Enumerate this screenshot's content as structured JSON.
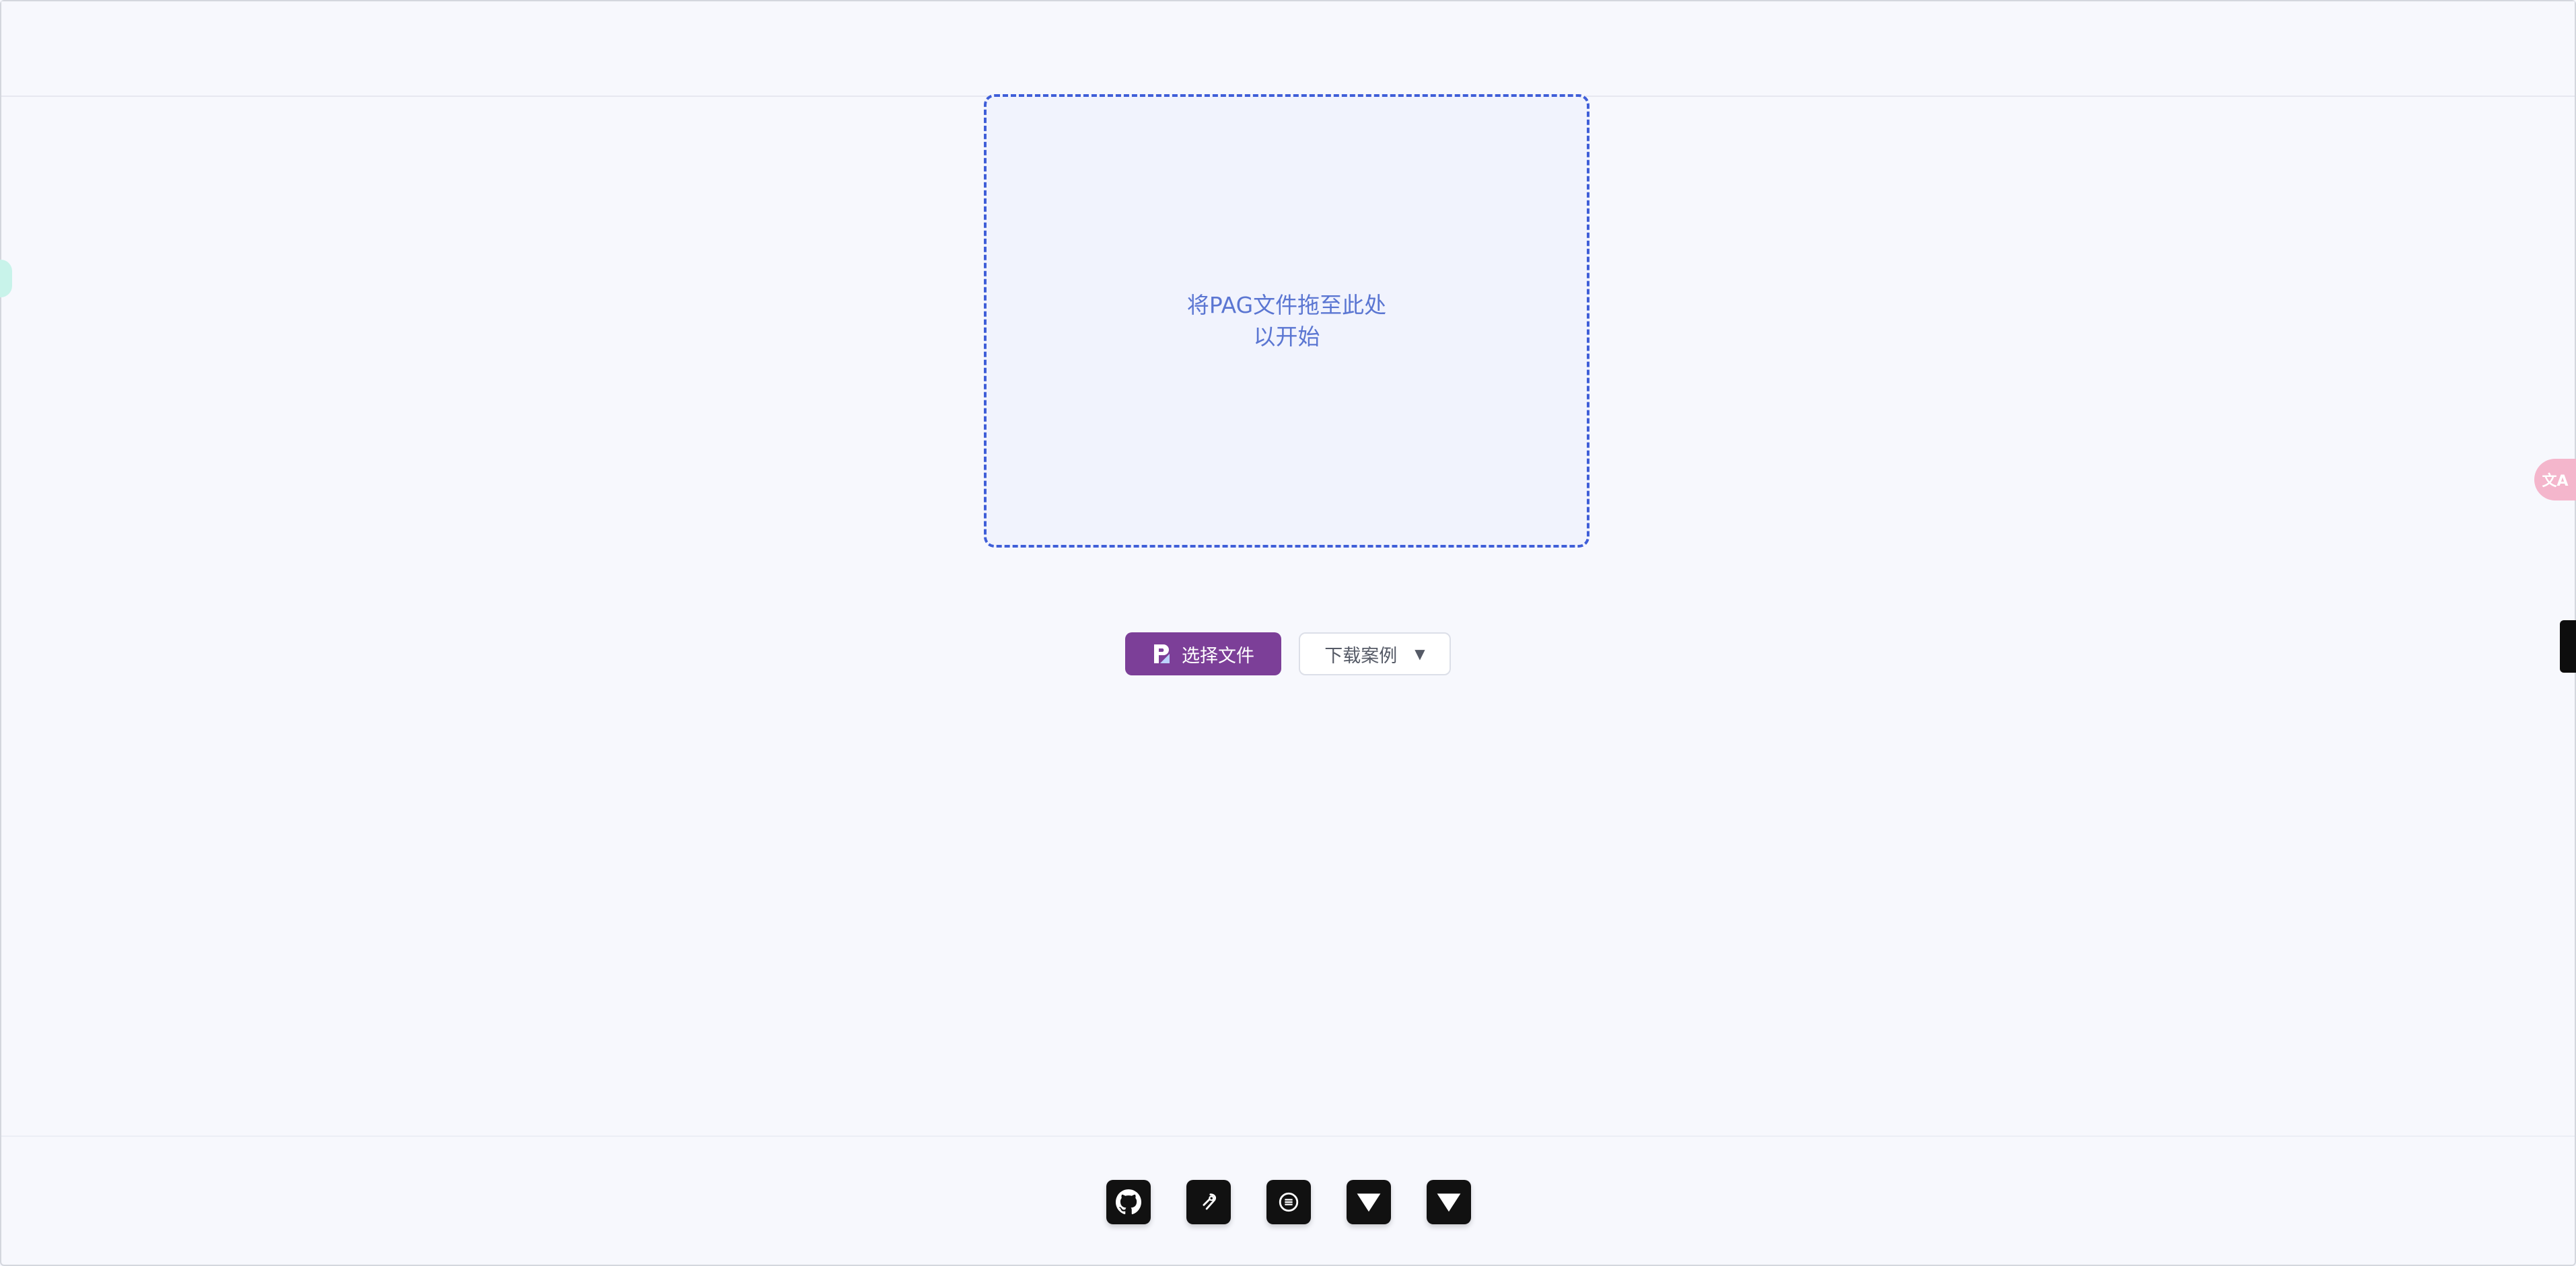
{
  "dropzone": {
    "line1": "将PAG文件拖至此处",
    "line2": "以开始"
  },
  "actions": {
    "choose_file_label": "选择文件",
    "download_examples_label": "下载案例",
    "dropdown_caret": "▼"
  },
  "footer": {
    "links": [
      "github-icon",
      "link-icon",
      "menu-icon",
      "vue-icon",
      "vue-icon"
    ]
  },
  "side_widgets": {
    "translate_label": "文A"
  },
  "colors": {
    "accent_purple": "#7c3f98",
    "dropzone_border": "#3f5ed8",
    "dropzone_text": "#5b76d2",
    "background": "#f7f8fd"
  }
}
